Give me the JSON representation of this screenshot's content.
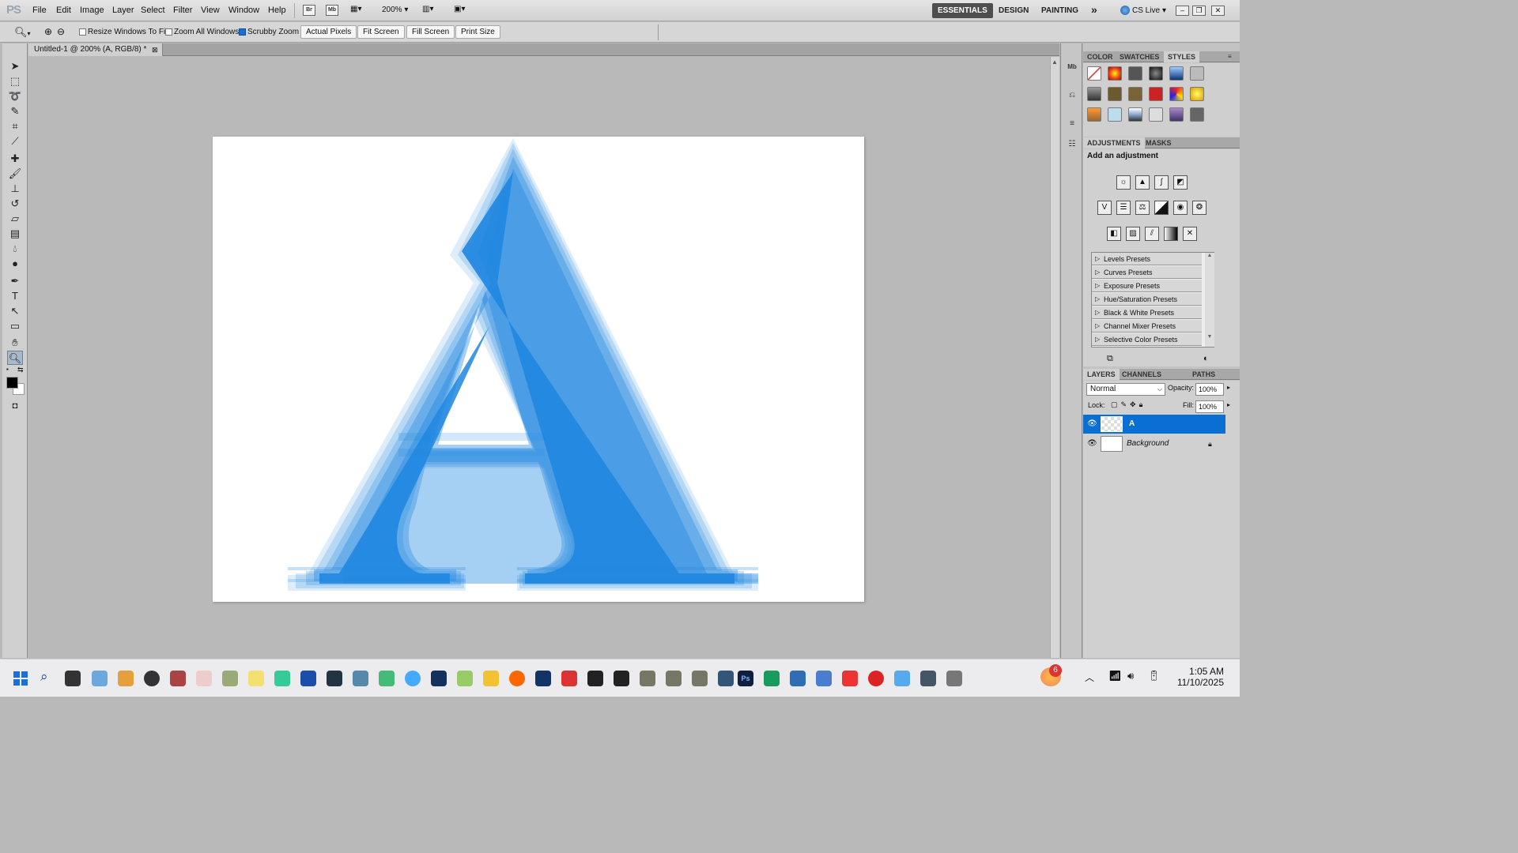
{
  "app": {
    "logo": "PS"
  },
  "menu": [
    "File",
    "Edit",
    "Image",
    "Layer",
    "Select",
    "Filter",
    "View",
    "Window",
    "Help"
  ],
  "appbar": {
    "bridge": "Br",
    "minibridge": "Mb",
    "zoom": "200%"
  },
  "workspaces": {
    "essentials": "ESSENTIALS",
    "design": "DESIGN",
    "painting": "PAINTING",
    "more": "»",
    "cslive": "CS Live"
  },
  "options": {
    "resize_windows": "Resize Windows To Fit",
    "zoom_all": "Zoom All Windows",
    "scrubby_zoom": "Scrubby Zoom",
    "actual_pixels": "Actual Pixels",
    "fit_screen": "Fit Screen",
    "fill_screen": "Fill Screen",
    "print_size": "Print Size"
  },
  "document": {
    "tab_title": "Untitled-1 @ 200% (A, RGB/8) *",
    "letter": "A"
  },
  "panels": {
    "color_tabs": [
      "COLOR",
      "SWATCHES",
      "STYLES"
    ],
    "adjust_tabs": [
      "ADJUSTMENTS",
      "MASKS"
    ],
    "adjust_heading": "Add an adjustment",
    "presets": [
      "Levels Presets",
      "Curves Presets",
      "Exposure Presets",
      "Hue/Saturation Presets",
      "Black & White Presets",
      "Channel Mixer Presets",
      "Selective Color Presets"
    ],
    "layers_tabs": [
      "LAYERS",
      "CHANNELS",
      "PATHS"
    ],
    "blend_mode": "Normal",
    "opacity_label": "Opacity:",
    "opacity": "100%",
    "lock_label": "Lock:",
    "fill_label": "Fill:",
    "fill": "100%",
    "layers": [
      {
        "name": "A"
      },
      {
        "name": "Background"
      }
    ]
  },
  "taskbar": {
    "time": "1:05 AM",
    "date": "11/10/2025",
    "badge": "6"
  },
  "colors": {
    "accent": "#1f86e0",
    "selected_layer": "#0a6fd3"
  }
}
